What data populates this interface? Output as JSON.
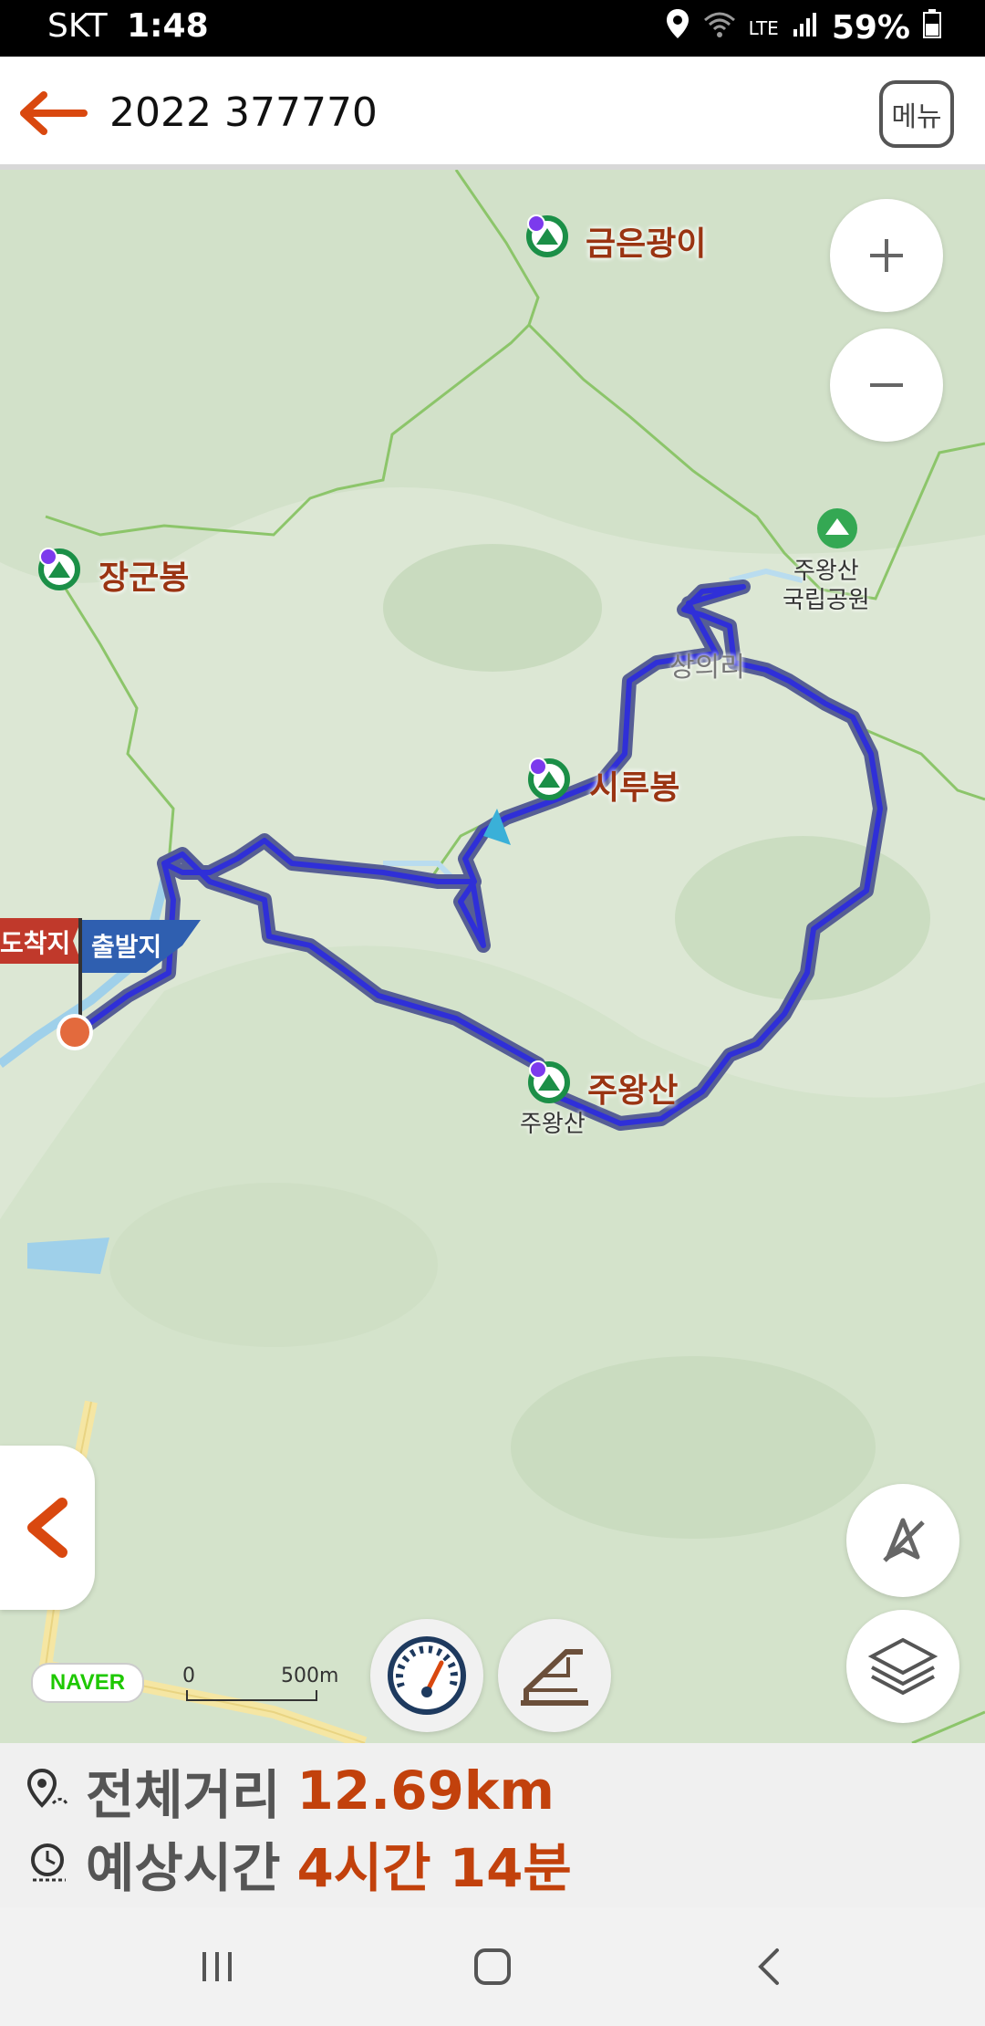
{
  "status_bar": {
    "carrier": "SKT",
    "time": "1:48",
    "network": "LTE",
    "battery": "59%"
  },
  "app_bar": {
    "title": "2022 377770",
    "menu_label": "메뉴"
  },
  "map": {
    "peaks": [
      {
        "name": "금은광이"
      },
      {
        "name": "장군봉"
      },
      {
        "name": "시루봉"
      },
      {
        "name": "주왕산"
      }
    ],
    "peak_sublabel": "주왕산",
    "park_label": "주왕산\n국립공원",
    "village_label": "상의리",
    "arrival_flag": "도착지",
    "departure_flag": "출발지",
    "naver_logo": "NAVER",
    "scale_zero": "0",
    "scale_distance": "500m",
    "colors": {
      "route": "#3a3ad6",
      "trail": "#8cc56a",
      "water": "#9fd0ea",
      "road": "#f5e6a3",
      "accent": "#d9480f"
    }
  },
  "info": {
    "distance_label": "전체거리",
    "distance_value": "12.69km",
    "time_label": "예상시간",
    "time_value": "4시간 14분"
  },
  "icons": {
    "back": "arrow-left-icon",
    "zoom_in": "plus-icon",
    "zoom_out": "minus-icon",
    "compass_off": "compass-off-icon",
    "layers": "layers-icon",
    "speed": "speedometer-icon",
    "elevation": "elevation-profile-icon",
    "collapse": "chevron-left-icon"
  }
}
